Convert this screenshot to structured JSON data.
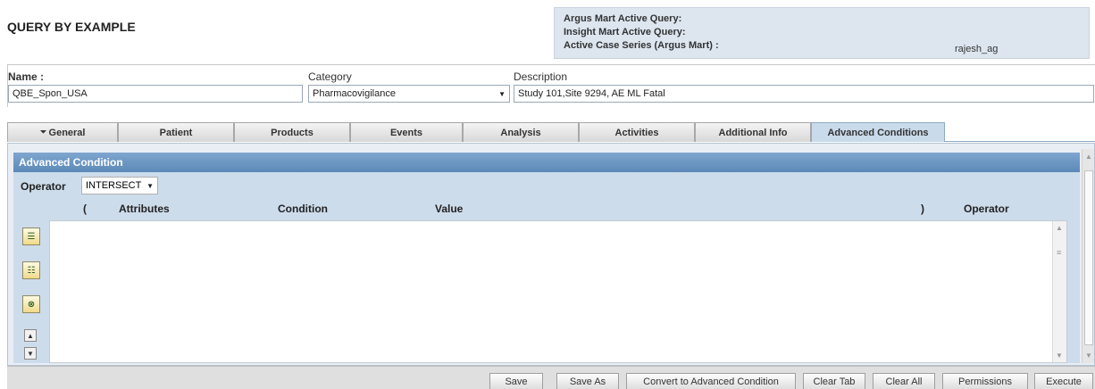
{
  "page": {
    "title": "QUERY BY EXAMPLE"
  },
  "active_query": {
    "argus_mart_label": "Argus Mart Active Query:",
    "insight_mart_label": "Insight Mart Active Query:",
    "active_case_series_label": "Active Case Series (Argus Mart) :",
    "user": "rajesh_ag"
  },
  "form": {
    "name_label": "Name :",
    "name_value": "QBE_Spon_USA",
    "category_label": "Category",
    "category_value": "Pharmacovigilance",
    "description_label": "Description",
    "description_value": "Study 101,Site 9294, AE ML Fatal"
  },
  "tabs": [
    {
      "label": "General",
      "active": false
    },
    {
      "label": "Patient",
      "active": false
    },
    {
      "label": "Products",
      "active": false
    },
    {
      "label": "Events",
      "active": false
    },
    {
      "label": "Analysis",
      "active": false
    },
    {
      "label": "Activities",
      "active": false
    },
    {
      "label": "Additional Info",
      "active": false
    },
    {
      "label": "Advanced Conditions",
      "active": true
    }
  ],
  "advanced": {
    "header": "Advanced Condition",
    "operator_label": "Operator",
    "operator_value": "INTERSECT",
    "columns": {
      "open_paren": "(",
      "attributes": "Attributes",
      "condition": "Condition",
      "value": "Value",
      "close_paren": ")",
      "operator": "Operator"
    }
  },
  "buttons": {
    "save": "Save",
    "save_as": "Save As",
    "convert": "Convert to Advanced Condition",
    "clear_tab": "Clear Tab",
    "clear_all": "Clear All",
    "permissions": "Permissions",
    "execute": "Execute"
  },
  "icons": {
    "add_condition": "add-condition-icon",
    "edit_condition": "edit-condition-icon",
    "delete_condition": "delete-condition-icon",
    "move_up": "arrow-up-icon",
    "move_down": "arrow-down-icon",
    "general_tab": "funnel-icon",
    "dropdown": "chevron-down-icon"
  },
  "colors": {
    "panel_bg": "#dde6ef",
    "adv_header": "#6a95c3",
    "adv_body": "#cddceb",
    "active_tab": "#c9daea"
  }
}
